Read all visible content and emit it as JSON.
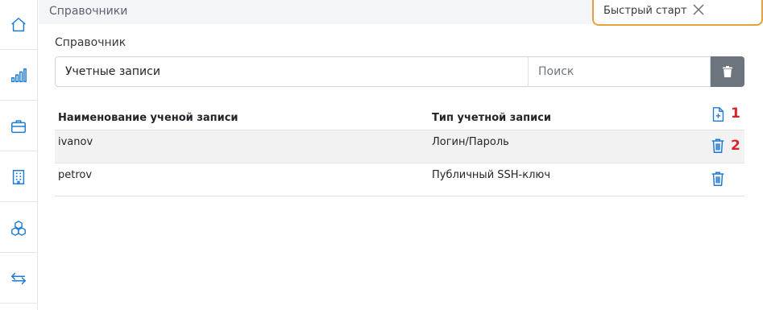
{
  "header": {
    "title": "Справочники"
  },
  "quick_start": {
    "label": "Быстрый старт"
  },
  "sidebar": {
    "items": [
      {
        "icon": "home-icon"
      },
      {
        "icon": "bar-chart-icon"
      },
      {
        "icon": "briefcase-icon"
      },
      {
        "icon": "building-icon"
      },
      {
        "icon": "boxes-icon"
      },
      {
        "icon": "arrows-exchange-icon"
      }
    ]
  },
  "dictionary": {
    "label": "Справочник",
    "selected": "Учетные записи",
    "search_placeholder": "Поиск"
  },
  "table": {
    "columns": [
      "Наименование ученой записи",
      "Тип учетной записи"
    ],
    "rows": [
      {
        "name": "ivanov",
        "type": "Логин/Пароль"
      },
      {
        "name": "petrov",
        "type": "Публичный SSH-ключ"
      }
    ]
  },
  "markers": {
    "add": "1",
    "delete": "2"
  },
  "colors": {
    "accent": "#1e7bd4",
    "marker": "#d9232d",
    "quick_start_border": "#e5a23a",
    "clear_button": "#6c757d"
  }
}
